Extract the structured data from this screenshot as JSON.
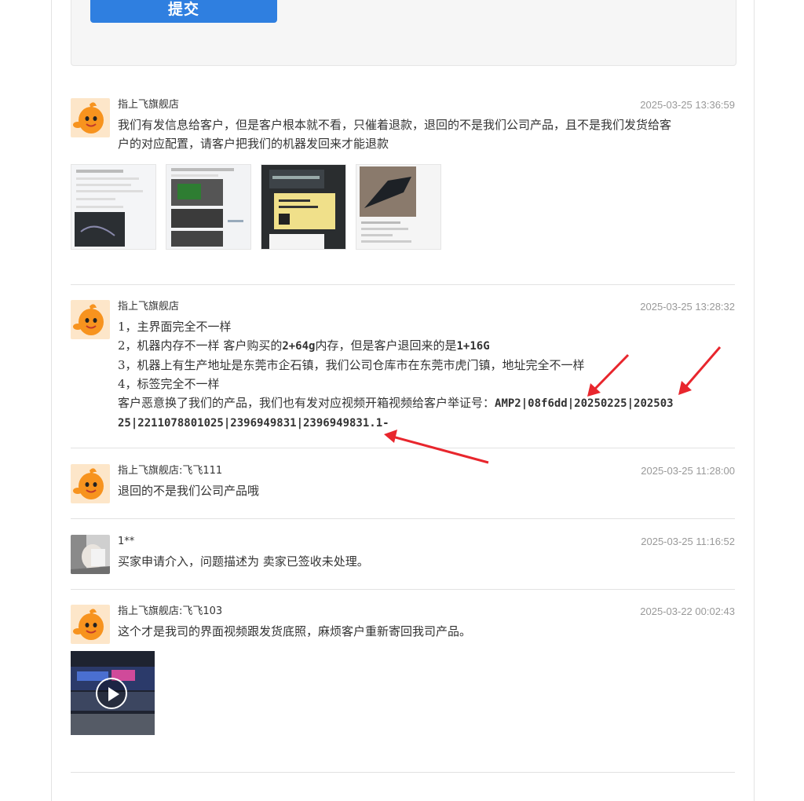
{
  "form": {
    "submit_label": "提交"
  },
  "entries": [
    {
      "name": "指上飞旗舰店",
      "time": "2025-03-25 13:36:59",
      "lines": [
        "我们有发信息给客户，但是客户根本就不看，只催着退款，退回的不是我们公司产品，且不是我们发货给客",
        "户的对应配置，请客户把我们的机器发回来才能退款"
      ],
      "images": [
        "chat-screenshot-thumbnail",
        "product-photo-thumbnail",
        "label-photo-thumbnail",
        "device-photo-thumbnail"
      ]
    },
    {
      "name": "指上飞旗舰店",
      "time": "2025-03-25 13:28:32",
      "items": [
        {
          "num": "1，",
          "text": "主界面完全不一样"
        },
        {
          "num": "2，",
          "pre": "机器内存不一样 客户购买的",
          "bold1": "2+64g",
          "mid": "内存，但是客户退回来的是",
          "bold2": "1+16G"
        },
        {
          "num": "3，",
          "text": "机器上有生产地址是东莞市企石镇，我们公司仓库市在东莞市虎门镇，地址完全不一样"
        },
        {
          "num": "4，",
          "text": "标签完全不一样"
        }
      ],
      "evidence_prefix": "客户恶意换了我们的产品，我们也有发对应视频开箱视频给客户举证号：",
      "evidence_code_1": "AMP2|08f6dd|20250225|202503",
      "evidence_code_2": "25|2211078801025|2396949831|2396949831.1-"
    },
    {
      "name": "指上飞旗舰店:飞飞111",
      "time": "2025-03-25 11:28:00",
      "lines": [
        "退回的不是我们公司产品哦"
      ]
    },
    {
      "name": "1**",
      "time": "2025-03-25 11:16:52",
      "lines": [
        "买家申请介入，问题描述为 卖家已签收未处理。"
      ]
    },
    {
      "name": "指上飞旗舰店:飞飞103",
      "time": "2025-03-22 00:02:43",
      "lines": [
        "这个才是我司的界面视频跟发货底照，麻烦客户重新寄回我司产品。"
      ],
      "video": "video-thumbnail"
    }
  ],
  "colors": {
    "accent": "#2f7fe0",
    "arrow": "#e8262d",
    "divider": "#e2e2e2",
    "time": "#999999"
  },
  "icons": {
    "avatar_store": "orange-mascot-avatar",
    "avatar_buyer": "buyer-photo-avatar",
    "play": "play-icon"
  }
}
